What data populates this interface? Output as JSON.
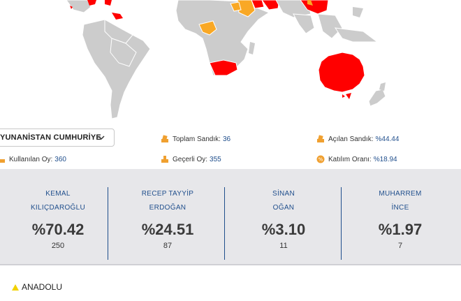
{
  "map": {
    "colors": {
      "gray": "#cccccc",
      "red": "#ff0000",
      "orange": "#f9a825",
      "border": "#ffffff",
      "water": "#ffffff"
    }
  },
  "filter": {
    "selected": "YUNANİSTAN CUMHURİYE",
    "chevron_icon": "chevron-down-icon"
  },
  "stats": {
    "toplam_sandik": {
      "label": "Toplam Sandık:",
      "value": "36",
      "icon": "ballot-box-icon"
    },
    "acilan_sandik": {
      "label": "Açılan Sandık:",
      "value": "%44.44",
      "icon": "open-ballot-icon"
    },
    "kullanilan_oy": {
      "label": "Kullanılan Oy:",
      "value": "360",
      "icon": "vote-icon"
    },
    "gecerli_oy": {
      "label": "Geçerli Oy:",
      "value": "355",
      "icon": "valid-vote-icon"
    },
    "katilim_orani": {
      "label": "Katılım Oranı:",
      "value": "%18.94",
      "icon": "percent-icon"
    }
  },
  "candidates": [
    {
      "first": "KEMAL",
      "last": "KILIÇDAROĞLU",
      "percent": "%70.42",
      "votes": "250"
    },
    {
      "first": "RECEP TAYYİP",
      "last": "ERDOĞAN",
      "percent": "%24.51",
      "votes": "87"
    },
    {
      "first": "SİNAN",
      "last": "OĞAN",
      "percent": "%3.10",
      "votes": "11"
    },
    {
      "first": "MUHARREM",
      "last": "İNCE",
      "percent": "%1.97",
      "votes": "7"
    }
  ],
  "footer": {
    "brand": "ANADOLU",
    "accent": "#f2d100"
  },
  "theme": {
    "accent_blue": "#1f4e8c",
    "icon_orange": "#f0a030",
    "panel_bg": "#e7e7ea"
  }
}
